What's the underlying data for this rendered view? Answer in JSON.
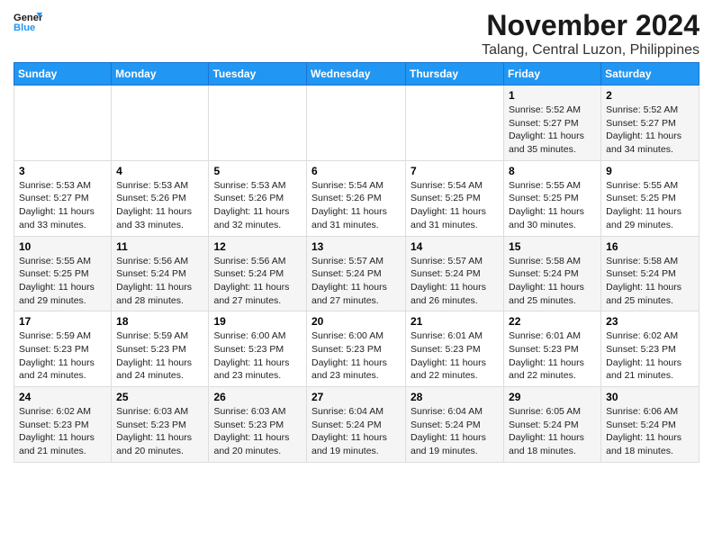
{
  "header": {
    "logo_line1": "General",
    "logo_line2": "Blue",
    "month_year": "November 2024",
    "location": "Talang, Central Luzon, Philippines"
  },
  "days_of_week": [
    "Sunday",
    "Monday",
    "Tuesday",
    "Wednesday",
    "Thursday",
    "Friday",
    "Saturday"
  ],
  "weeks": [
    [
      {
        "day": "",
        "detail": ""
      },
      {
        "day": "",
        "detail": ""
      },
      {
        "day": "",
        "detail": ""
      },
      {
        "day": "",
        "detail": ""
      },
      {
        "day": "",
        "detail": ""
      },
      {
        "day": "1",
        "detail": "Sunrise: 5:52 AM\nSunset: 5:27 PM\nDaylight: 11 hours\nand 35 minutes."
      },
      {
        "day": "2",
        "detail": "Sunrise: 5:52 AM\nSunset: 5:27 PM\nDaylight: 11 hours\nand 34 minutes."
      }
    ],
    [
      {
        "day": "3",
        "detail": "Sunrise: 5:53 AM\nSunset: 5:27 PM\nDaylight: 11 hours\nand 33 minutes."
      },
      {
        "day": "4",
        "detail": "Sunrise: 5:53 AM\nSunset: 5:26 PM\nDaylight: 11 hours\nand 33 minutes."
      },
      {
        "day": "5",
        "detail": "Sunrise: 5:53 AM\nSunset: 5:26 PM\nDaylight: 11 hours\nand 32 minutes."
      },
      {
        "day": "6",
        "detail": "Sunrise: 5:54 AM\nSunset: 5:26 PM\nDaylight: 11 hours\nand 31 minutes."
      },
      {
        "day": "7",
        "detail": "Sunrise: 5:54 AM\nSunset: 5:25 PM\nDaylight: 11 hours\nand 31 minutes."
      },
      {
        "day": "8",
        "detail": "Sunrise: 5:55 AM\nSunset: 5:25 PM\nDaylight: 11 hours\nand 30 minutes."
      },
      {
        "day": "9",
        "detail": "Sunrise: 5:55 AM\nSunset: 5:25 PM\nDaylight: 11 hours\nand 29 minutes."
      }
    ],
    [
      {
        "day": "10",
        "detail": "Sunrise: 5:55 AM\nSunset: 5:25 PM\nDaylight: 11 hours\nand 29 minutes."
      },
      {
        "day": "11",
        "detail": "Sunrise: 5:56 AM\nSunset: 5:24 PM\nDaylight: 11 hours\nand 28 minutes."
      },
      {
        "day": "12",
        "detail": "Sunrise: 5:56 AM\nSunset: 5:24 PM\nDaylight: 11 hours\nand 27 minutes."
      },
      {
        "day": "13",
        "detail": "Sunrise: 5:57 AM\nSunset: 5:24 PM\nDaylight: 11 hours\nand 27 minutes."
      },
      {
        "day": "14",
        "detail": "Sunrise: 5:57 AM\nSunset: 5:24 PM\nDaylight: 11 hours\nand 26 minutes."
      },
      {
        "day": "15",
        "detail": "Sunrise: 5:58 AM\nSunset: 5:24 PM\nDaylight: 11 hours\nand 25 minutes."
      },
      {
        "day": "16",
        "detail": "Sunrise: 5:58 AM\nSunset: 5:24 PM\nDaylight: 11 hours\nand 25 minutes."
      }
    ],
    [
      {
        "day": "17",
        "detail": "Sunrise: 5:59 AM\nSunset: 5:23 PM\nDaylight: 11 hours\nand 24 minutes."
      },
      {
        "day": "18",
        "detail": "Sunrise: 5:59 AM\nSunset: 5:23 PM\nDaylight: 11 hours\nand 24 minutes."
      },
      {
        "day": "19",
        "detail": "Sunrise: 6:00 AM\nSunset: 5:23 PM\nDaylight: 11 hours\nand 23 minutes."
      },
      {
        "day": "20",
        "detail": "Sunrise: 6:00 AM\nSunset: 5:23 PM\nDaylight: 11 hours\nand 23 minutes."
      },
      {
        "day": "21",
        "detail": "Sunrise: 6:01 AM\nSunset: 5:23 PM\nDaylight: 11 hours\nand 22 minutes."
      },
      {
        "day": "22",
        "detail": "Sunrise: 6:01 AM\nSunset: 5:23 PM\nDaylight: 11 hours\nand 22 minutes."
      },
      {
        "day": "23",
        "detail": "Sunrise: 6:02 AM\nSunset: 5:23 PM\nDaylight: 11 hours\nand 21 minutes."
      }
    ],
    [
      {
        "day": "24",
        "detail": "Sunrise: 6:02 AM\nSunset: 5:23 PM\nDaylight: 11 hours\nand 21 minutes."
      },
      {
        "day": "25",
        "detail": "Sunrise: 6:03 AM\nSunset: 5:23 PM\nDaylight: 11 hours\nand 20 minutes."
      },
      {
        "day": "26",
        "detail": "Sunrise: 6:03 AM\nSunset: 5:23 PM\nDaylight: 11 hours\nand 20 minutes."
      },
      {
        "day": "27",
        "detail": "Sunrise: 6:04 AM\nSunset: 5:24 PM\nDaylight: 11 hours\nand 19 minutes."
      },
      {
        "day": "28",
        "detail": "Sunrise: 6:04 AM\nSunset: 5:24 PM\nDaylight: 11 hours\nand 19 minutes."
      },
      {
        "day": "29",
        "detail": "Sunrise: 6:05 AM\nSunset: 5:24 PM\nDaylight: 11 hours\nand 18 minutes."
      },
      {
        "day": "30",
        "detail": "Sunrise: 6:06 AM\nSunset: 5:24 PM\nDaylight: 11 hours\nand 18 minutes."
      }
    ]
  ]
}
